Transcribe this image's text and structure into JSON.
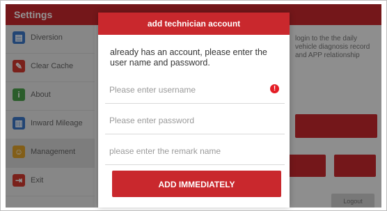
{
  "header": {
    "title": "Settings"
  },
  "sidebar": {
    "items": [
      {
        "label": "Diversion",
        "icon": "folder-icon",
        "color": "#3b78c8"
      },
      {
        "label": "Clear Cache",
        "icon": "broom-icon",
        "color": "#d33a30"
      },
      {
        "label": "About",
        "icon": "info-icon",
        "color": "#4aa14a"
      },
      {
        "label": "Inward Mileage",
        "icon": "chart-icon",
        "color": "#3b78c8"
      },
      {
        "label": "Management",
        "icon": "people-icon",
        "color": "#e0a32a"
      },
      {
        "label": "Exit",
        "icon": "exit-icon",
        "color": "#d33a30"
      }
    ]
  },
  "background": {
    "text": "login to the the daily vehicle diagnosis record and APP relationship",
    "red_button_label": "",
    "grey_button_label": "Logout"
  },
  "dialog": {
    "title": "add technician account",
    "message": "already has an account, please enter the user name and password.",
    "username_placeholder": "Please enter username",
    "password_placeholder": "Please enter password",
    "remark_placeholder": "please enter the remark name",
    "add_button_label": "ADD IMMEDIATELY",
    "error_icon": "!"
  },
  "colors": {
    "brand": "#c9282d",
    "error": "#e41e26"
  }
}
